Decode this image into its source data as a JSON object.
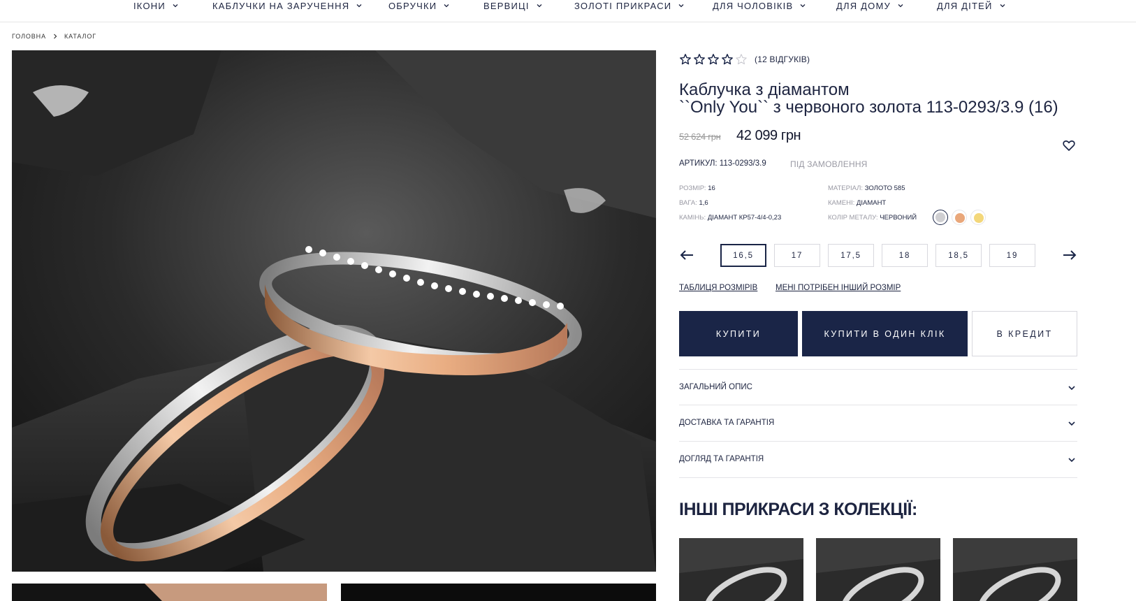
{
  "nav": {
    "items": [
      {
        "label": "ІКОНИ"
      },
      {
        "label": "КАБЛУЧКИ НА ЗАРУЧЕННЯ"
      },
      {
        "label": "ОБРУЧКИ"
      },
      {
        "label": "ВЕРВИЦІ"
      },
      {
        "label": "ЗОЛОТІ ПРИКРАСИ"
      },
      {
        "label": "ДЛЯ ЧОЛОВІКІВ"
      },
      {
        "label": "ДЛЯ ДОМУ"
      },
      {
        "label": "ДЛЯ ДІТЕЙ"
      }
    ]
  },
  "breadcrumb": {
    "home": "ГОЛОВНА",
    "catalog": "КАТАЛОГ"
  },
  "product": {
    "rating": {
      "stars": 4,
      "max": 5,
      "reviews": "(12 ВІДГУКІВ)"
    },
    "title_line1": "Каблучка з діамантом",
    "title_line2": "``Only You`` з червоного золота 113-0293/3.9 (16)",
    "old_price": "52 624 грн",
    "new_price": "42 099 грн",
    "sku": "АРТИКУЛ: 113-0293/3.9",
    "status": "ПІД ЗАМОВЛЕННЯ",
    "specs": {
      "size_key": "РОЗМІР:",
      "size_val": "16",
      "weight_key": "ВАГА:",
      "weight_val": "1,6",
      "stone_key": "КАМІНЬ:",
      "stone_val": "ДІАМАНТ КР57-4/4-0,23",
      "material_key": "МАТЕРІАЛ:",
      "material_val": "ЗОЛОТО 585",
      "stones_key": "КАМЕНІ:",
      "stones_val": "ДІАМАНТ",
      "color_key": "КОЛІР МЕТАЛУ:",
      "color_val": "ЧЕРВОНИЙ"
    },
    "metal_swatches": [
      {
        "name": "white",
        "color": "#cfcfd2",
        "selected": true
      },
      {
        "name": "red",
        "color": "#e9a77a",
        "selected": false
      },
      {
        "name": "yellow",
        "color": "#f3d77a",
        "selected": false
      }
    ],
    "sizes": [
      "16,5",
      "17",
      "17,5",
      "18",
      "18,5",
      "19"
    ],
    "active_size": "16,5",
    "links": {
      "size_table": "ТАБЛИЦЯ РОЗМІРІВ",
      "other_size": "МЕНІ ПОТРІБЕН ІНШИЙ РОЗМІР"
    },
    "buttons": {
      "buy": "КУПИТИ",
      "one_click": "КУПИТИ В ОДИН КЛІК",
      "credit": "В КРЕДИТ"
    },
    "accordion": [
      "ЗАГАЛЬНИЙ ОПИС",
      "ДОСТАВКА ТА ГАРАНТІЯ",
      "ДОГЛЯД ТА ГАРАНТІЯ"
    ],
    "collection_title": "ІНШІ ПРИКРАСИ З КОЛЕКЦІЇ:"
  },
  "colors": {
    "brand_navy": "#1a2547",
    "muted": "#9a9aa4"
  }
}
